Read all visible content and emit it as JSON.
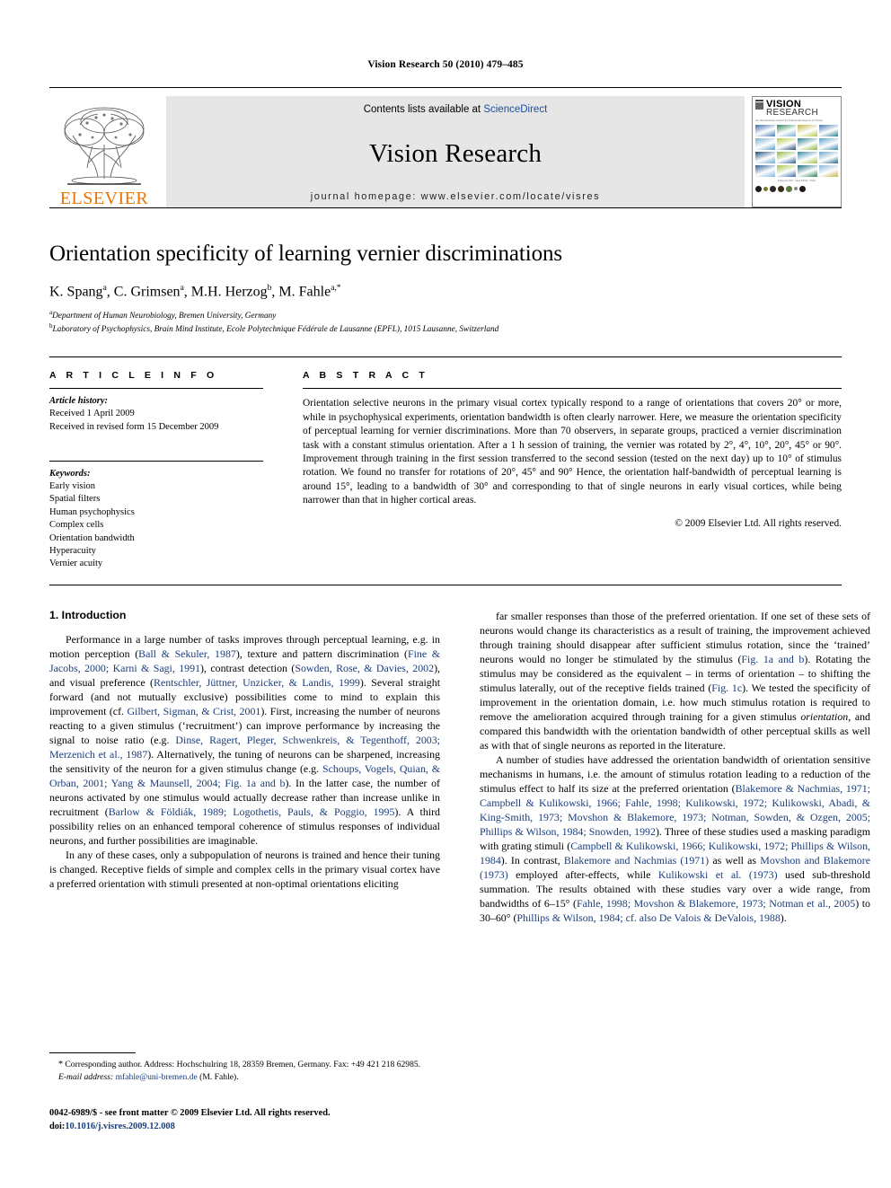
{
  "running_head": "Vision Research 50 (2010) 479–485",
  "masthead": {
    "contents_prefix": "Contents lists available at ",
    "sciencedirect": "ScienceDirect",
    "journal_title": "Vision Research",
    "homepage": "journal homepage: www.elsevier.com/locate/visres",
    "publisher": "ELSEVIER",
    "cover": {
      "title_line1": "VISION",
      "title_line2": "RESEARCH",
      "subtitle": "An International Journal for Functional Aspects of Vision",
      "caption": "Editors-in-Chief  ·  Guest Editing  ·  Vision",
      "swatch_colors": [
        "#3a6ea8",
        "#2c8a5a",
        "#c2b44a",
        "#4a7ab5",
        "#7ab0d4",
        "#b8c94e",
        "#2f7f8d",
        "#5e9ec4",
        "#1d4f7c",
        "#8fb93f",
        "#3d87a8",
        "#6fa8cc",
        "#2a5f96",
        "#a8c44a",
        "#1f6b82",
        "#87b6d8"
      ],
      "dot_colors": [
        "#1a1a1a",
        "#7a7a2a",
        "#2a2a2a",
        "#3a2a1a",
        "#5a7a3a",
        "#8a8a8a",
        "#1a1a1a"
      ]
    },
    "accent_orange": "#ec7404",
    "link_blue": "#1a4fa0"
  },
  "title": "Orientation specificity of learning vernier discriminations",
  "authors": [
    {
      "name": "K. Spang",
      "sup": "a"
    },
    {
      "name": "C. Grimsen",
      "sup": "a"
    },
    {
      "name": "M.H. Herzog",
      "sup": "b"
    },
    {
      "name": "M. Fahle",
      "sup": "a,*"
    }
  ],
  "authors_line": "K. Spang a, C. Grimsen a, M.H. Herzog b, M. Fahle a,*",
  "affiliations": [
    {
      "sup": "a",
      "text": "Department of Human Neurobiology, Bremen University, Germany"
    },
    {
      "sup": "b",
      "text": "Laboratory of Psychophysics, Brain Mind Institute, Ecole Polytechnique Fédérale de Lausanne (EPFL), 1015 Lausanne, Switzerland"
    }
  ],
  "article_info": {
    "heading": "A R T I C L E    I N F O",
    "history_label": "Article history:",
    "history": [
      "Received 1 April 2009",
      "Received in revised form 15 December 2009"
    ],
    "keywords_label": "Keywords:",
    "keywords": [
      "Early vision",
      "Spatial filters",
      "Human psychophysics",
      "Complex cells",
      "Orientation bandwidth",
      "Hyperacuity",
      "Vernier acuity"
    ]
  },
  "abstract": {
    "heading": "A B S T R A C T",
    "text": "Orientation selective neurons in the primary visual cortex typically respond to a range of orientations that covers 20° or more, while in psychophysical experiments, orientation bandwidth is often clearly narrower. Here, we measure the orientation specificity of perceptual learning for vernier discriminations. More than 70 observers, in separate groups, practiced a vernier discrimination task with a constant stimulus orientation. After a 1 h session of training, the vernier was rotated by 2°, 4°, 10°, 20°, 45° or 90°. Improvement through training in the first session transferred to the second session (tested on the next day) up to 10° of stimulus rotation. We found no transfer for rotations of 20°, 45° and 90° Hence, the orientation half-bandwidth of perceptual learning is around 15°, leading to a bandwidth of 30° and corresponding to that of single neurons in early visual cortices, while being narrower than that in higher cortical areas.",
    "copyright": "© 2009 Elsevier Ltd. All rights reserved."
  },
  "section": {
    "number_title": "1. Introduction"
  },
  "left_column": {
    "paragraphs": [
      [
        {
          "t": "Performance in a large number of tasks improves through perceptual learning, e.g. in motion perception ("
        },
        {
          "t": "Ball & Sekuler, 1987",
          "ref": true
        },
        {
          "t": "), texture and pattern discrimination ("
        },
        {
          "t": "Fine & Jacobs, 2000; Karni & Sagi, 1991",
          "ref": true
        },
        {
          "t": "), contrast detection ("
        },
        {
          "t": "Sowden, Rose, & Davies, 2002",
          "ref": true
        },
        {
          "t": "), and visual preference ("
        },
        {
          "t": "Rentschler, Jüttner, Unzicker, & Landis, 1999",
          "ref": true
        },
        {
          "t": "). Several straight forward (and not mutually exclusive) possibilities come to mind to explain this improvement (cf. "
        },
        {
          "t": "Gilbert, Sigman, & Crist, 2001",
          "ref": true
        },
        {
          "t": "). First, increasing the number of neurons reacting to a given stimulus (‘recruitment’) can improve performance by increasing the signal to noise ratio (e.g. "
        },
        {
          "t": "Dinse, Ragert, Pleger, Schwenkreis, & Tegenthoff, 2003; Merzenich et al., 1987",
          "ref": true
        },
        {
          "t": "). Alternatively, the tuning of neurons can be sharpened, increasing the sensitivity of the neuron for a given stimulus change (e.g. "
        },
        {
          "t": "Schoups, Vogels, Quian, & Orban, 2001; Yang & Maunsell, 2004; Fig. 1a and b",
          "ref": true
        },
        {
          "t": "). In the latter case, the number of neurons activated by one stimulus would actually decrease rather than increase unlike in recruitment ("
        },
        {
          "t": "Barlow & Földiák, 1989; Logothetis, Pauls, & Poggio, 1995",
          "ref": true
        },
        {
          "t": "). A third possibility relies on an enhanced temporal coherence of stimulus responses of individual neurons, and further possibilities are imaginable."
        }
      ],
      [
        {
          "t": "In any of these cases, only a subpopulation of neurons is trained and hence their tuning is changed. Receptive fields of simple and complex cells in the primary visual cortex have a preferred orientation with stimuli presented at non-optimal orientations eliciting"
        }
      ]
    ],
    "footnote": {
      "star": "*",
      "corresponding": " Corresponding author. Address: Hochschulring 18, 28359 Bremen, Germany. Fax: +49 421 218 62985.",
      "email_label": "E-mail address:",
      "email": "mfahle@uni-bremen.de",
      "email_suffix": " (M. Fahle)."
    }
  },
  "right_column": {
    "paragraphs": [
      [
        {
          "t": "far smaller responses than those of the preferred orientation. If one set of these sets of neurons would change its characteristics as a result of training, the improvement achieved through training should disappear after sufficient stimulus rotation, since the ‘trained’ neurons would no longer be stimulated by the stimulus ("
        },
        {
          "t": "Fig. 1a and b",
          "ref": true
        },
        {
          "t": "). Rotating the stimulus may be considered as the equivalent – in terms of orientation – to shifting the stimulus laterally, out of the receptive fields trained ("
        },
        {
          "t": "Fig. 1c",
          "ref": true
        },
        {
          "t": "). We tested the specificity of improvement in the orientation domain, i.e. how much stimulus rotation is required to remove the amelioration acquired through training for a given stimulus "
        },
        {
          "t": "orientation",
          "italic": true
        },
        {
          "t": ", and compared this bandwidth with the orientation bandwidth of other perceptual skills as well as with that of single neurons as reported in the literature."
        }
      ],
      [
        {
          "t": "A number of studies have addressed the orientation bandwidth of orientation sensitive mechanisms in humans, i.e. the amount of stimulus rotation leading to a reduction of the stimulus effect to half its size at the preferred orientation ("
        },
        {
          "t": "Blakemore & Nachmias, 1971; Campbell & Kulikowski, 1966; Fahle, 1998; Kulikowski, 1972; Kulikowski, Abadi, & King-Smith, 1973; Movshon & Blakemore, 1973; Notman, Sowden, & Ozgen, 2005; Phillips & Wilson, 1984; Snowden, 1992",
          "ref": true
        },
        {
          "t": "). Three of these studies used a masking paradigm with grating stimuli ("
        },
        {
          "t": "Campbell & Kulikowski, 1966; Kulikowski, 1972; Phillips & Wilson, 1984",
          "ref": true
        },
        {
          "t": "). In contrast, "
        },
        {
          "t": "Blakemore and Nachmias (1971)",
          "ref": true
        },
        {
          "t": " as well as "
        },
        {
          "t": "Movshon and Blakemore (1973)",
          "ref": true
        },
        {
          "t": " employed after-effects, while "
        },
        {
          "t": "Kulikowski et al. (1973)",
          "ref": true
        },
        {
          "t": " used sub-threshold summation. The results obtained with these studies vary over a wide range, from bandwidths of 6–15° ("
        },
        {
          "t": "Fahle, 1998; Movshon & Blakemore, 1973; Notman et al., 2005",
          "ref": true
        },
        {
          "t": ") to 30–60° ("
        },
        {
          "t": "Phillips & Wilson, 1984; cf. also De Valois & DeValois, 1988",
          "ref": true
        },
        {
          "t": ")."
        }
      ]
    ]
  },
  "footer": {
    "issn_line": "0042-6989/$ - see front matter © 2009 Elsevier Ltd. All rights reserved.",
    "doi_label": "doi:",
    "doi": "10.1016/j.visres.2009.12.008"
  }
}
